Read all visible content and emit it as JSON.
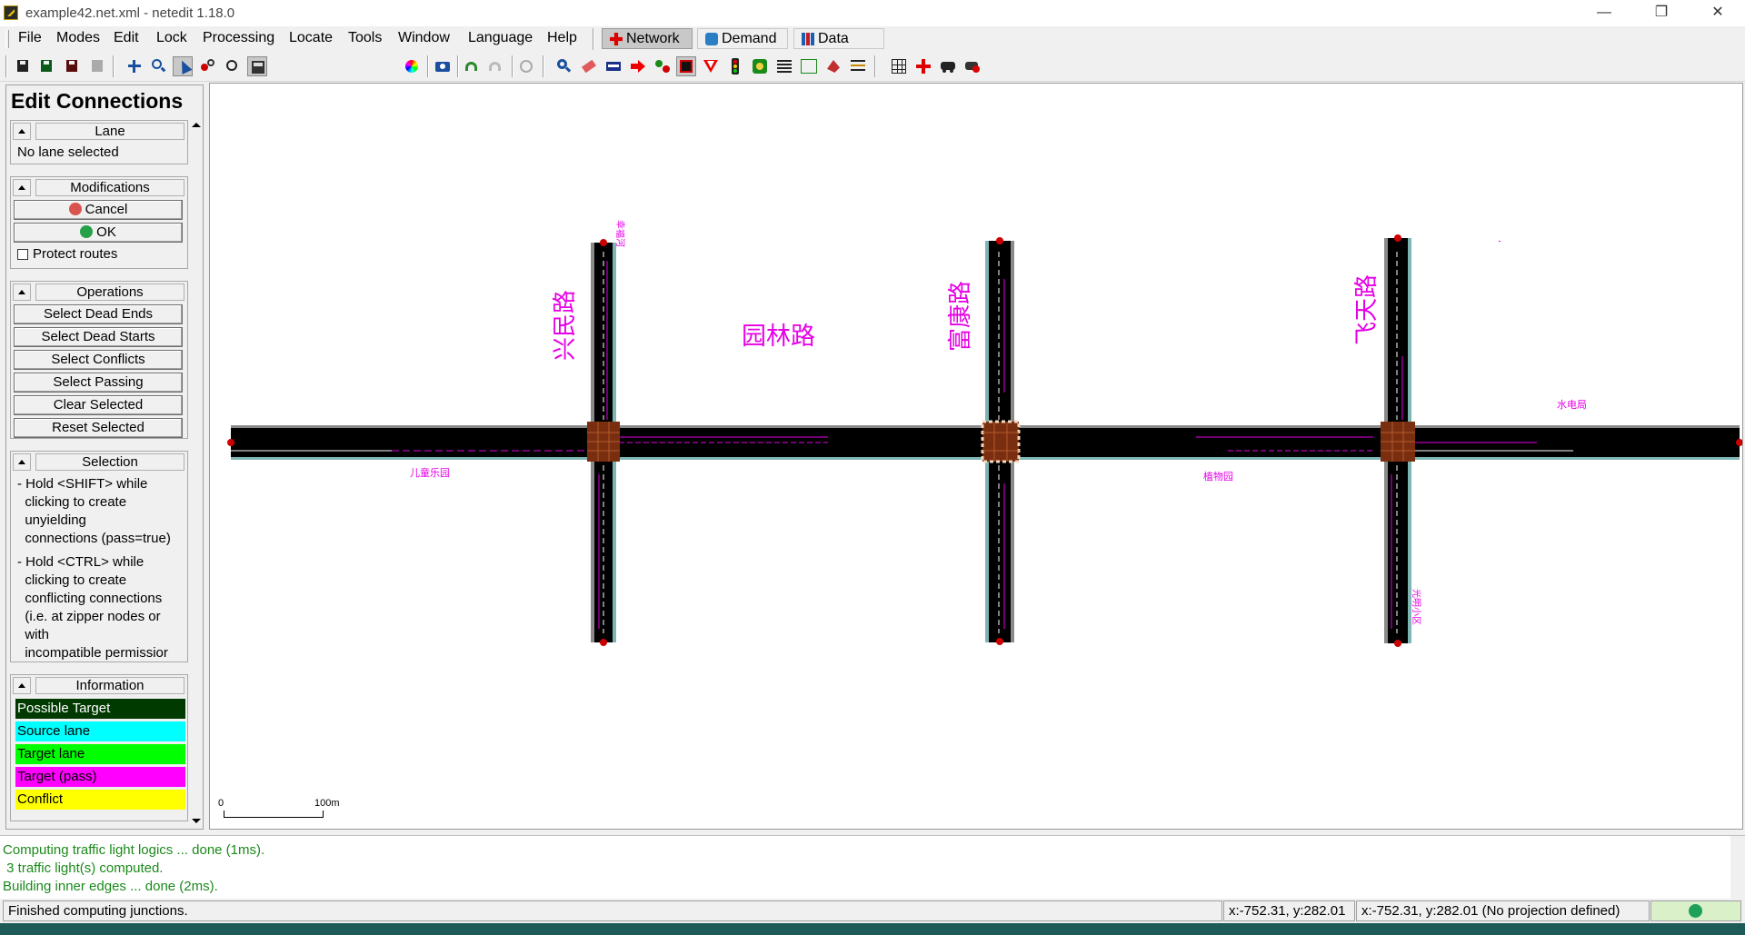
{
  "window": {
    "title": "example42.net.xml - netedit 1.18.0",
    "minimize": "—",
    "maximize": "❐",
    "close": "✕"
  },
  "menu": {
    "items": [
      "File",
      "Modes",
      "Edit",
      "Lock",
      "Processing",
      "Locate",
      "Tools",
      "Window",
      "Language",
      "Help"
    ],
    "modes": [
      {
        "label": "Network",
        "active": true
      },
      {
        "label": "Demand",
        "active": false
      },
      {
        "label": "Data",
        "active": false
      }
    ]
  },
  "toolbar": {
    "scheme_value": "standard"
  },
  "panel": {
    "title": "Edit Connections",
    "lane": {
      "header": "Lane",
      "text": "No lane selected"
    },
    "modifications": {
      "header": "Modifications",
      "cancel": "Cancel",
      "ok": "OK",
      "protect_routes": "Protect routes"
    },
    "operations": {
      "header": "Operations",
      "buttons": [
        "Select Dead Ends",
        "Select Dead Starts",
        "Select Conflicts",
        "Select Passing",
        "Clear Selected",
        "Reset Selected"
      ]
    },
    "selection": {
      "header": "Selection",
      "lines": [
        "- Hold <SHIFT> while",
        "  clicking to create",
        "  unyielding",
        "  connections (pass=true)",
        "- Hold <CTRL> while",
        "  clicking to create",
        "  conflicting connections",
        "  (i.e. at zipper nodes or",
        "  with",
        "  incompatible permissior"
      ]
    },
    "information": {
      "header": "Information",
      "legend": [
        {
          "label": "Possible Target",
          "color": "#003a00",
          "text_color": "#ffffff"
        },
        {
          "label": "Source lane",
          "color": "#00ffff",
          "text_color": "#000000"
        },
        {
          "label": "Target lane",
          "color": "#00ff00",
          "text_color": "#000000"
        },
        {
          "label": "Target (pass)",
          "color": "#ff00ff",
          "text_color": "#000000"
        },
        {
          "label": "Conflict",
          "color": "#ffff00",
          "text_color": "#000000"
        }
      ]
    }
  },
  "map": {
    "labels": {
      "xingmin": "兴民路",
      "yuanlin": "园林路",
      "fukang": "富康路",
      "feitian": "飞天路",
      "small_1": "幸福河",
      "small_2": "儿童乐园",
      "small_3": "植物园",
      "small_4": "水电局",
      "small_5": "光明小区"
    },
    "scale": {
      "start": "0",
      "end": "100m"
    },
    "colors": {
      "road": "#000000",
      "junction": "#7a2e10",
      "label": "#e600e6",
      "node": "#cc0000"
    }
  },
  "messages": [
    "Computing traffic light logics ... done (1ms).",
    " 3 traffic light(s) computed.",
    "Building inner edges ... done (2ms)."
  ],
  "status": {
    "message": "Finished computing junctions.",
    "coords_1": "x:-752.31, y:282.01",
    "coords_2": "x:-752.31, y:282.01 (No projection defined)"
  }
}
